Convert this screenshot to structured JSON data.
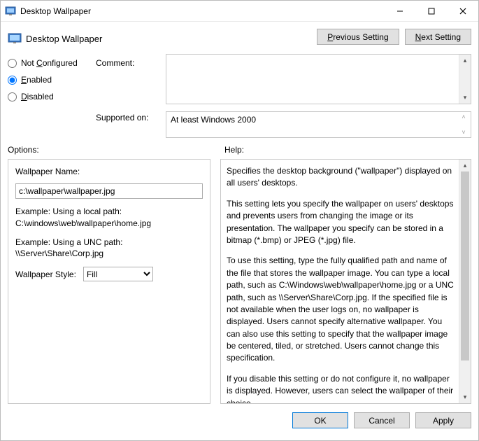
{
  "window": {
    "title": "Desktop Wallpaper"
  },
  "header": {
    "policy_name": "Desktop Wallpaper",
    "prev_button_prefix": "P",
    "prev_button_rest": "revious Setting",
    "next_button_prefix": "N",
    "next_button_rest": "ext Setting"
  },
  "state": {
    "not_configured_prefix": "Not",
    "not_configured_ul": "C",
    "not_configured_rest": "onfigured",
    "enabled_ul": "E",
    "enabled_rest": "nabled",
    "disabled_ul": "D",
    "disabled_rest": "isabled",
    "comment_label": "Comment:",
    "supported_label": "Supported on:",
    "supported_value": "At least Windows 2000"
  },
  "panels": {
    "options_label": "Options:",
    "help_label": "Help:"
  },
  "options": {
    "wallpaper_name_label": "Wallpaper Name:",
    "wallpaper_name_value": "c:\\wallpaper\\wallpaper.jpg",
    "example1_line1": "Example: Using a local path:",
    "example1_line2": "C:\\windows\\web\\wallpaper\\home.jpg",
    "example2_line1": "Example: Using a UNC path:",
    "example2_line2": "\\\\Server\\Share\\Corp.jpg",
    "wallpaper_style_label": "Wallpaper Style:",
    "wallpaper_style_value": "Fill"
  },
  "help": {
    "p1": "Specifies the desktop background (\"wallpaper\") displayed on all users' desktops.",
    "p2": "This setting lets you specify the wallpaper on users' desktops and prevents users from changing the image or its presentation. The wallpaper you specify can be stored in a bitmap (*.bmp) or JPEG (*.jpg) file.",
    "p3": "To use this setting, type the fully qualified path and name of the file that stores the wallpaper image. You can type a local path, such as C:\\Windows\\web\\wallpaper\\home.jpg or a UNC path, such as \\\\Server\\Share\\Corp.jpg. If the specified file is not available when the user logs on, no wallpaper is displayed. Users cannot specify alternative wallpaper. You can also use this setting to specify that the wallpaper image be centered, tiled, or stretched. Users cannot change this specification.",
    "p4": "If you disable this setting or do not configure it, no wallpaper is displayed. However, users can select the wallpaper of their choice."
  },
  "footer": {
    "ok": "OK",
    "cancel": "Cancel",
    "apply": "Apply"
  }
}
